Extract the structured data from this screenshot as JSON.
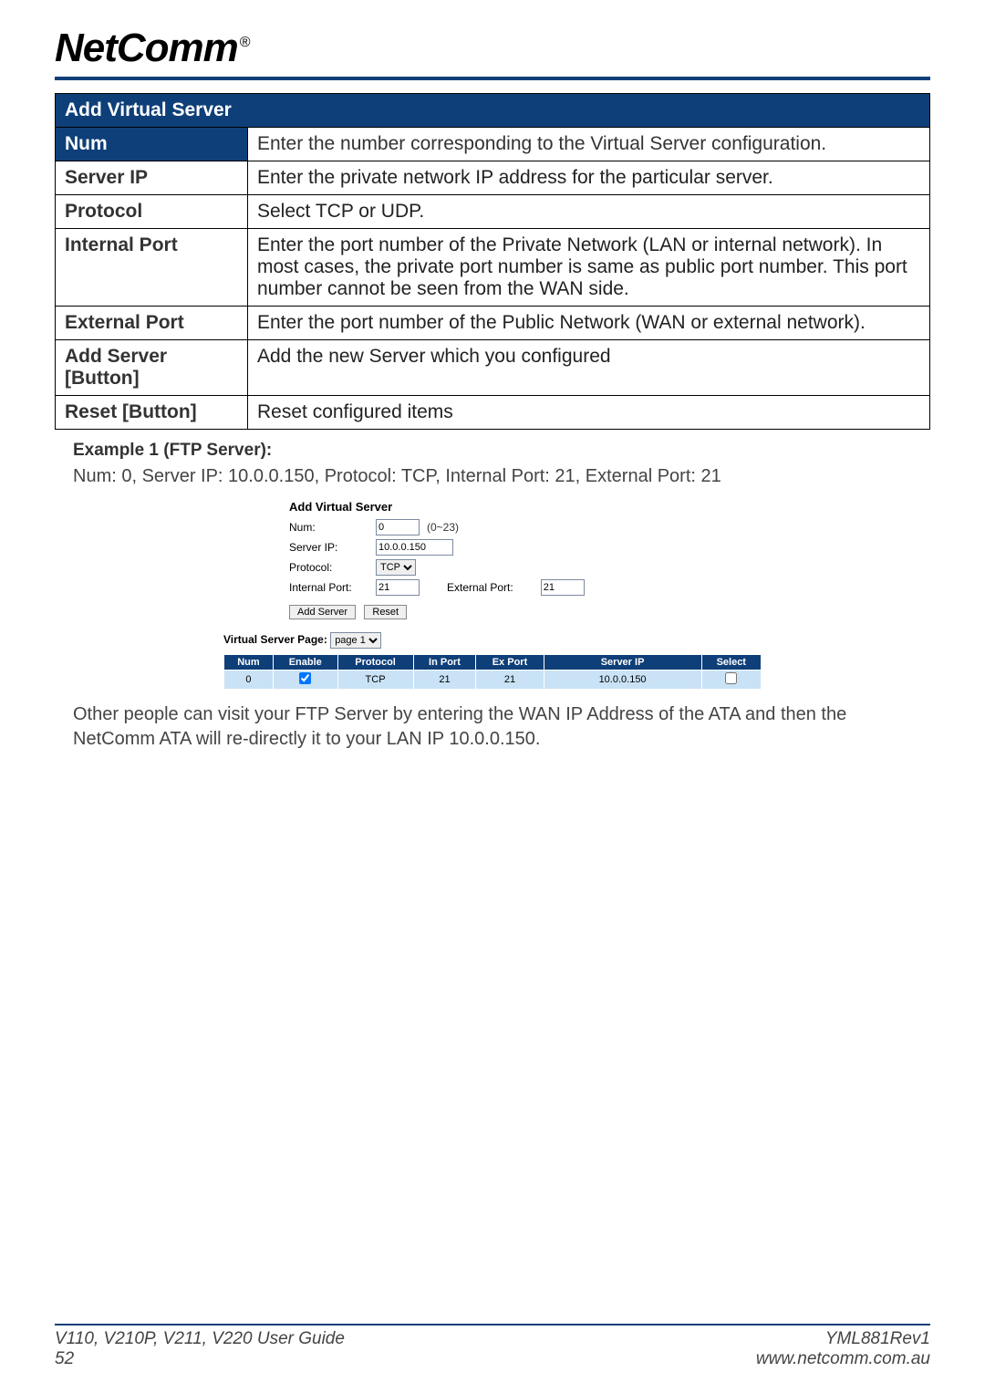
{
  "brand": "NetComm",
  "brand_mark": "®",
  "def_table": {
    "header": "Add Virtual Server",
    "rows": [
      {
        "label": "Num",
        "desc": "Enter the number corresponding to the Virtual Server configuration.",
        "label_in_header": true
      },
      {
        "label": "Server IP",
        "desc": "Enter the private network IP address for the particular server."
      },
      {
        "label": "Protocol",
        "desc": "Select TCP or UDP."
      },
      {
        "label": "Internal Port",
        "desc": "Enter the port number of the Private Network (LAN or internal network). In most cases, the private port number is same as public port number. This port number cannot be seen from the WAN side."
      },
      {
        "label": "External Port",
        "desc": "Enter the port number of the Public Network (WAN or external network)."
      },
      {
        "label": "Add Server [Button]",
        "desc": "Add the new Server which you configured"
      },
      {
        "label": "Reset [Button]",
        "desc": "Reset configured items"
      }
    ]
  },
  "example_heading": "Example 1 (FTP Server):",
  "example_line": "Num: 0, Server IP: 10.0.0.150, Protocol: TCP, Internal Port: 21, External Port: 21",
  "ui": {
    "title": "Add Virtual Server",
    "num_label": "Num:",
    "num_value": "0",
    "num_hint": "(0~23)",
    "server_ip_label": "Server IP:",
    "server_ip_value": "10.0.0.150",
    "protocol_label": "Protocol:",
    "protocol_value": "TCP",
    "internal_port_label": "Internal Port:",
    "internal_port_value": "21",
    "external_port_label": "External Port:",
    "external_port_value": "21",
    "add_btn": "Add Server",
    "reset_btn": "Reset",
    "vs_page_label": "Virtual Server Page:",
    "vs_page_value": "page 1",
    "vs_headers": [
      "Num",
      "Enable",
      "Protocol",
      "In Port",
      "Ex Port",
      "Server IP",
      "Select"
    ],
    "vs_row": {
      "num": "0",
      "enable": true,
      "protocol": "TCP",
      "in_port": "21",
      "ex_port": "21",
      "server_ip": "10.0.0.150",
      "select": false
    }
  },
  "after_text": "Other people can visit your FTP Server by entering the WAN IP Address of the ATA and then the NetComm ATA will re-directly it to your LAN IP 10.0.0.150.",
  "footer": {
    "left1": "V110, V210P, V211, V220 User Guide",
    "left2": "52",
    "right1": "YML881Rev1",
    "right2": "www.netcomm.com.au"
  }
}
